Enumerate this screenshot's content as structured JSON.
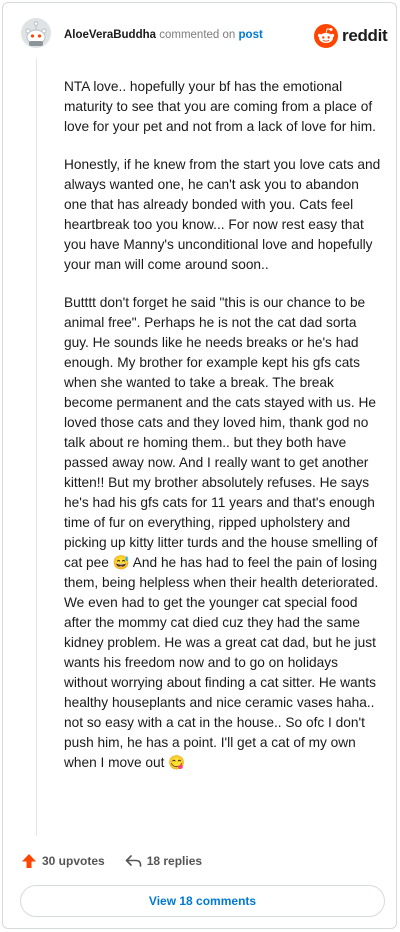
{
  "header": {
    "username": "AloeVeraBuddha",
    "commented_on": "commented on",
    "post_link": "post",
    "brand_name": "reddit"
  },
  "comment": {
    "paragraphs": [
      "NTA love.. hopefully your bf has the emotional maturity to see that you are coming from a place of love for your pet and not from a lack of love for him.",
      "Honestly, if he knew from the start you love cats and always wanted one, he can't ask you to abandon one that has already bonded with you. Cats feel heartbreak too you know... For now rest easy that you have Manny's unconditional love and hopefully your man will come around soon..",
      "Butttt don't forget he said \"this is our chance to be animal free\". Perhaps he is not the cat dad sorta guy. He sounds like he needs breaks or he's had enough. My brother for example kept his gfs cats when she wanted to take a break. The break become permanent and the cats stayed with us. He loved those cats and they loved him, thank god no talk about re homing them.. but they both have passed away now. And I really want to get another kitten!! But my brother absolutely refuses. He says he's had his gfs cats for 11 years and that's enough time of fur on everything, ripped upholstery and picking up kitty litter turds and the house smelling of cat pee 😅 And he has had to feel the pain of losing them, being helpless when their health deteriorated. We even had to get the younger cat special food after the mommy cat died cuz they had the same kidney problem. He was a great cat dad, but he just wants his freedom now and to go on holidays without worrying about finding a cat sitter. He wants healthy houseplants and nice ceramic vases haha.. not so easy with a cat in the house.. So ofc I don't push him, he has a point. I'll get a cat of my own when I move out 😋"
    ]
  },
  "footer": {
    "upvotes": "30 upvotes",
    "replies": "18 replies",
    "view_comments": "View 18 comments"
  },
  "icons": {
    "avatar": "snoo-avatar-icon",
    "brand": "reddit-logo-icon",
    "upvote": "upvote-arrow-icon",
    "reply": "reply-arrow-icon"
  },
  "colors": {
    "brand_orange": "#ff4500",
    "link_blue": "#0079d3",
    "upvote_orange": "#ff4500"
  }
}
